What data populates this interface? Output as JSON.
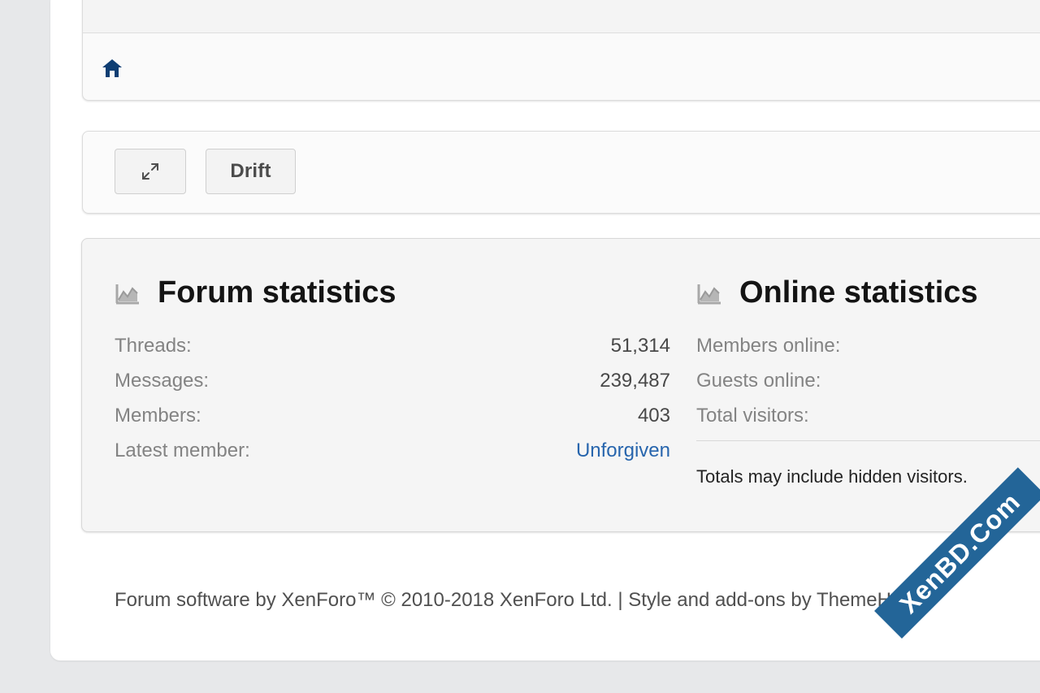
{
  "colors": {
    "page_bg": "#e7e8ea",
    "card_bg": "#f5f5f5",
    "link": "#2765ad",
    "home_icon": "#0f3e73",
    "watermark": "#236598"
  },
  "icons": {
    "home": "home-icon",
    "expand": "expand-icon",
    "chart": "chart-icon"
  },
  "toolbar": {
    "drift_label": "Drift"
  },
  "forum_statistics": {
    "title": "Forum statistics",
    "rows": [
      {
        "label": "Threads:",
        "value": "51,314"
      },
      {
        "label": "Messages:",
        "value": "239,487"
      },
      {
        "label": "Members:",
        "value": "403"
      },
      {
        "label": "Latest member:",
        "value": "Unforgiven"
      }
    ]
  },
  "online_statistics": {
    "title": "Online statistics",
    "rows": [
      {
        "label": "Members online:"
      },
      {
        "label": "Guests online:"
      },
      {
        "label": "Total visitors:"
      }
    ],
    "note": "Totals may include hidden visitors."
  },
  "footer": {
    "text": "Forum software by XenForo™ © 2010-2018 XenForo Ltd. | Style and add-ons by ThemeHouse"
  },
  "watermark": {
    "text": "XenBD.Com"
  }
}
